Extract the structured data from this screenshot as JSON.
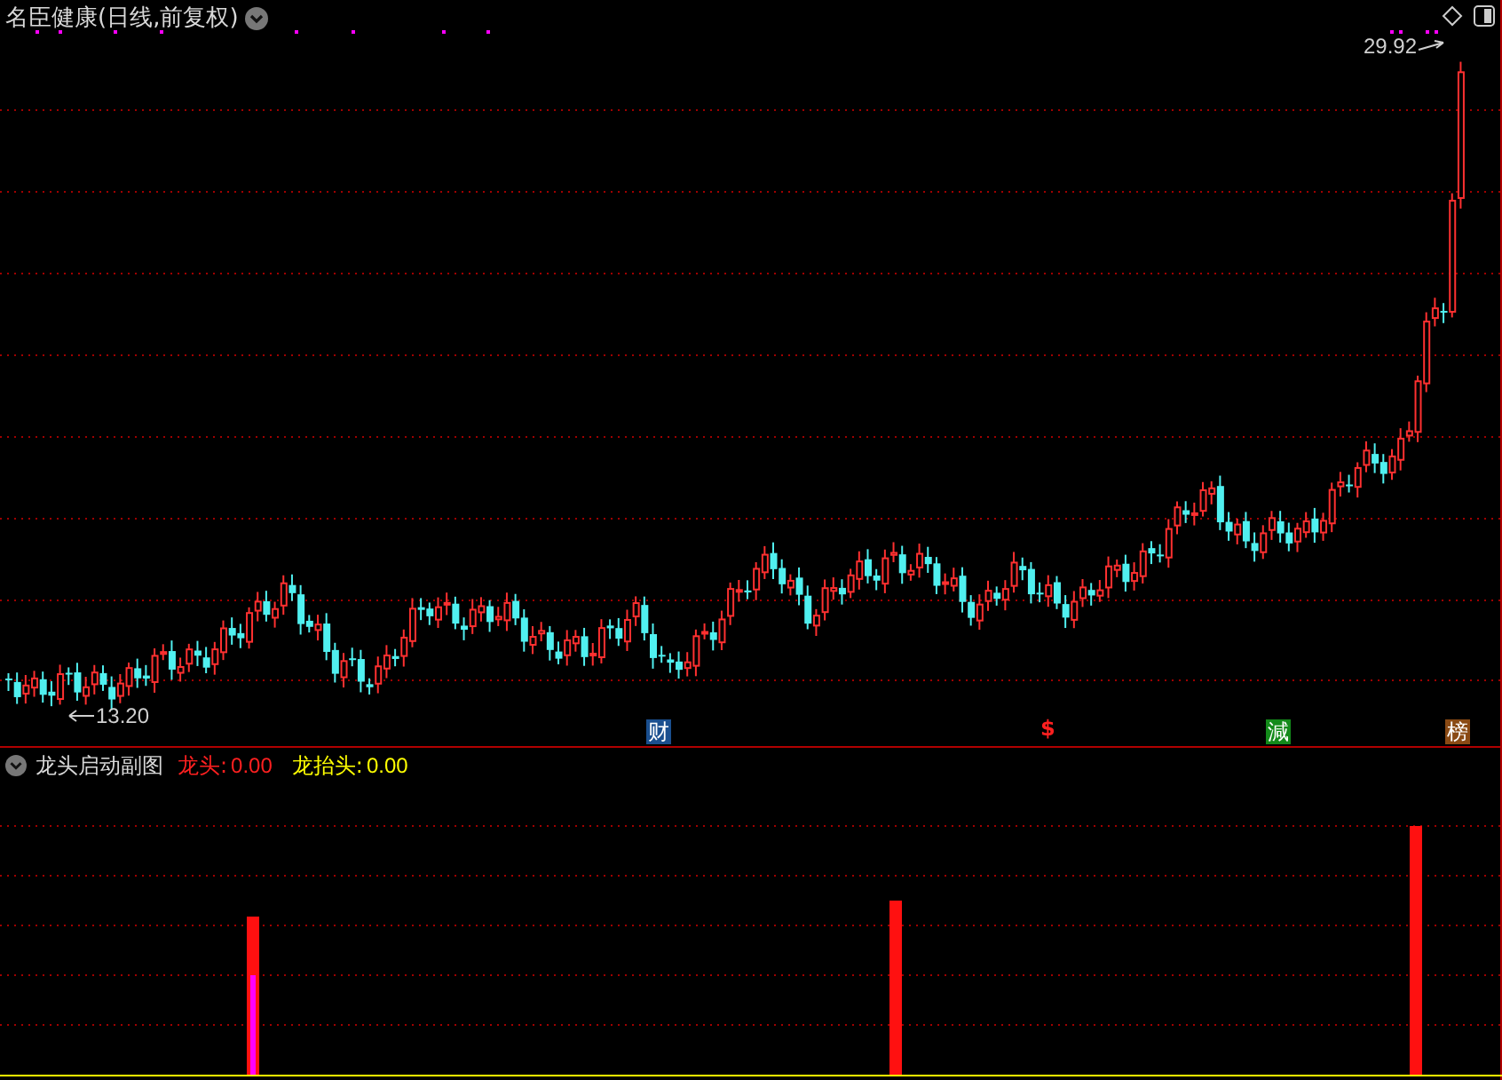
{
  "chart_title": "名臣健康(日线,前复权)",
  "price_labels": [
    {
      "kind": "high",
      "text": "29.92"
    },
    {
      "kind": "low",
      "text": "13.20"
    }
  ],
  "event_markers": [
    {
      "kind": "badge",
      "text": "财",
      "color": "#1a4f8f"
    },
    {
      "kind": "glyph",
      "text": "$",
      "color": "#ff2020"
    },
    {
      "kind": "badge",
      "text": "減",
      "color": "#138a1a"
    },
    {
      "kind": "badge",
      "text": "榜",
      "color": "#8a4a14"
    }
  ],
  "indicator": {
    "name": "龙头启动副图",
    "legend": [
      {
        "label": "龙头:",
        "value": "0.00",
        "color": "#ff2020"
      },
      {
        "label": "龙抬头:",
        "value": "0.00",
        "color": "#ffff00"
      }
    ]
  }
}
